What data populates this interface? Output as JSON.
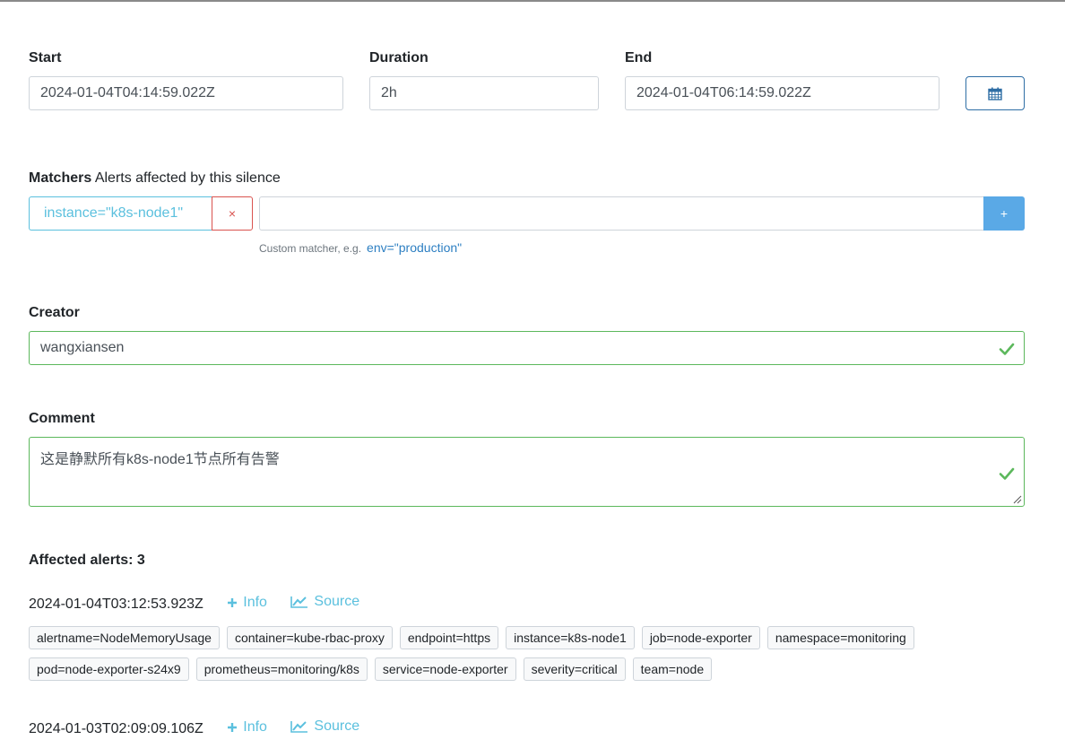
{
  "time": {
    "start_label": "Start",
    "start_value": "2024-01-04T04:14:59.022Z",
    "duration_label": "Duration",
    "duration_value": "2h",
    "end_label": "End",
    "end_value": "2024-01-04T06:14:59.022Z",
    "calendar_icon": "calendar-icon"
  },
  "matchers": {
    "label": "Matchers",
    "description": "Alerts affected by this silence",
    "existing": "instance=\"k8s-node1\"",
    "remove": "×",
    "add": "+",
    "hint": "Custom matcher, e.g.",
    "hint_example": "env=\"production\""
  },
  "creator": {
    "label": "Creator",
    "value": "wangxiansen"
  },
  "comment": {
    "label": "Comment",
    "value": "这是静默所有k8s-node1节点所有告警"
  },
  "affected": {
    "label": "Affected alerts: 3",
    "alerts": [
      {
        "timestamp": "2024-01-04T03:12:53.923Z",
        "info": "Info",
        "source": "Source",
        "labels_row1": [
          "alertname=NodeMemoryUsage",
          "container=kube-rbac-proxy",
          "endpoint=https",
          "instance=k8s-node1",
          "job=node-exporter",
          "namespace=monitoring"
        ],
        "labels_row2": [
          "pod=node-exporter-s24x9",
          "prometheus=monitoring/k8s",
          "service=node-exporter",
          "severity=critical",
          "team=node"
        ]
      },
      {
        "timestamp": "2024-01-03T02:09:09.106Z",
        "info": "Info",
        "source": "Source"
      }
    ]
  },
  "colors": {
    "info": "#5bc0de",
    "valid": "#5cb85c",
    "danger": "#d9534f",
    "primary": "#5aa9e6"
  }
}
